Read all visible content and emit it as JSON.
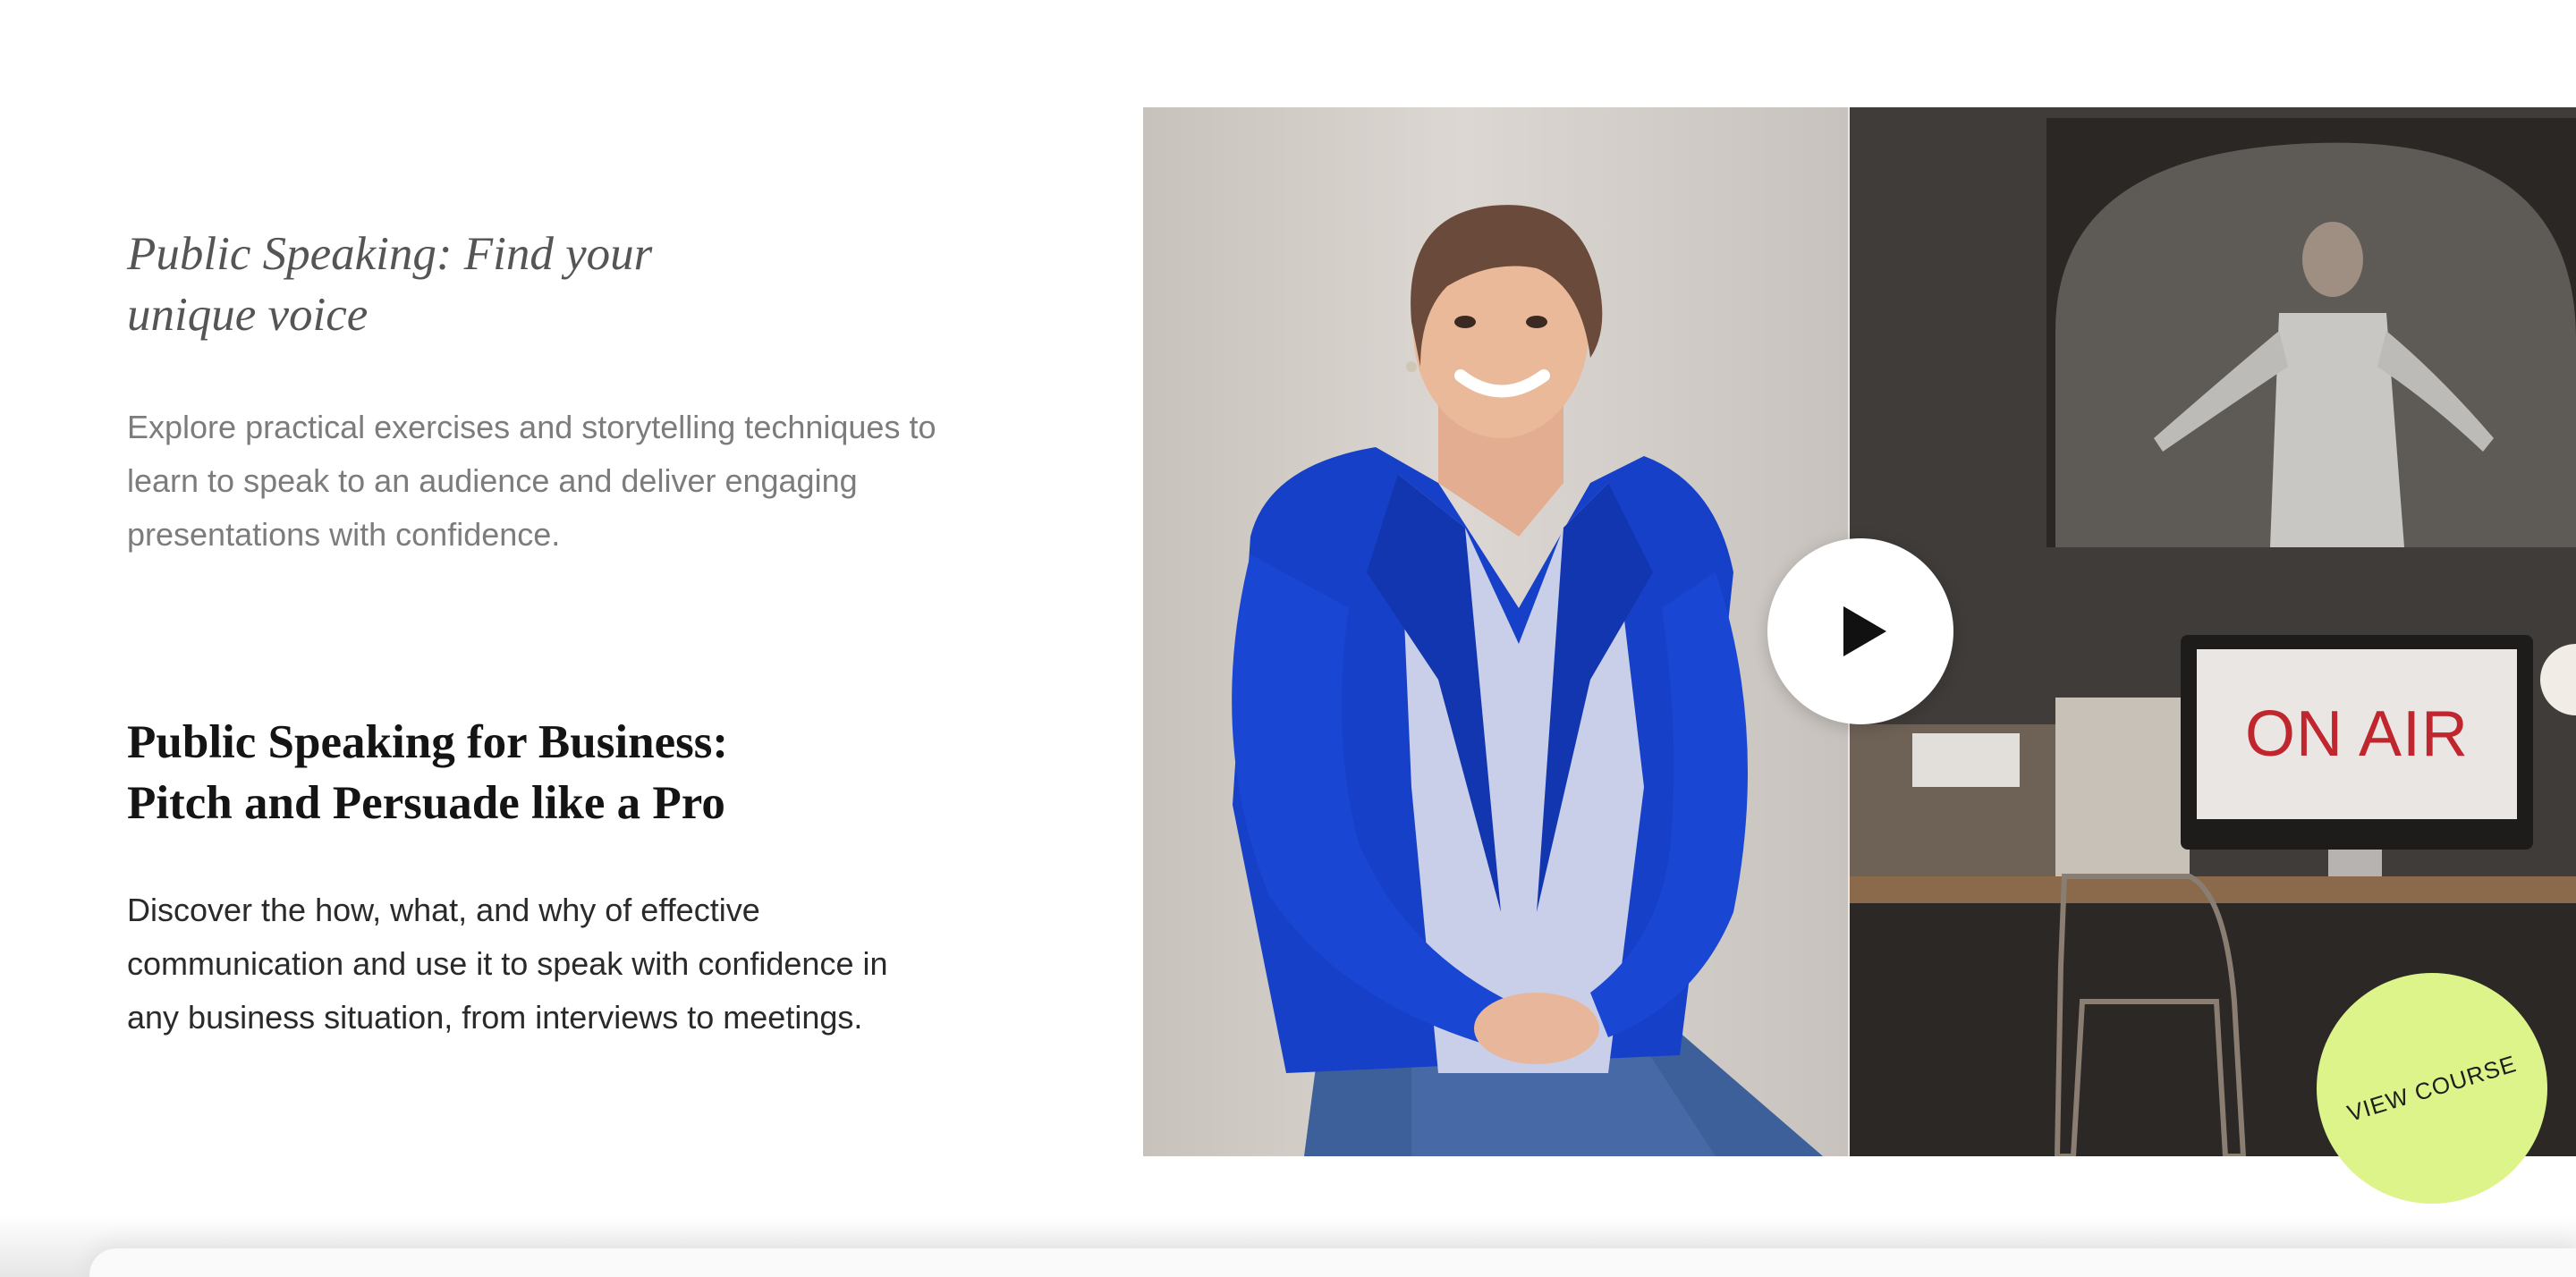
{
  "courses": [
    {
      "title": "Public Speaking: Find your\nunique voice",
      "description": "Explore practical exercises and storytelling techniques to\nlearn to speak to an audience and deliver engaging\npresentations with confidence."
    },
    {
      "title": "Public Speaking for Business:\nPitch and Persuade like a Pro",
      "description": "Discover the how, what, and why of effective\ncommunication and use it to speak with confidence in\nany business situation, from interviews to meetings."
    }
  ],
  "media": {
    "monitor_text": "ON AIR",
    "play_icon": "play-icon",
    "view_course_label": "VIEW COURSE"
  },
  "colors": {
    "badge": "#dcf48a",
    "blazer": "#1740c9",
    "on_air_red": "#c0262e"
  }
}
